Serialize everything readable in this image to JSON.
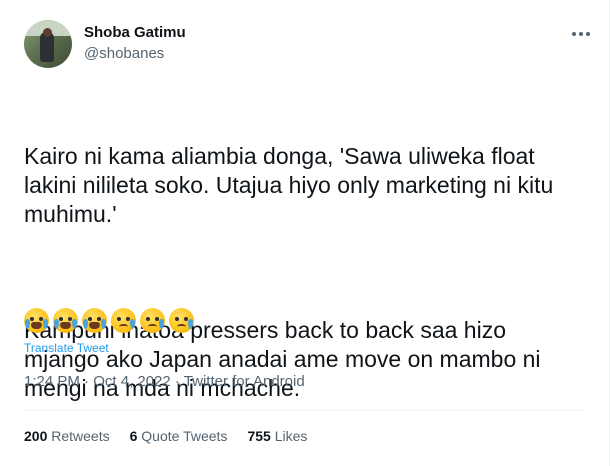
{
  "author": {
    "name": "Shoba Gatimu",
    "handle": "@shobanes"
  },
  "tweet": {
    "paragraph1": "Kairo ni kama aliambia donga, 'Sawa uliweka float lakini nilileta soko. Utajua hiyo only marketing ni kitu muhimu.'",
    "paragraph2": "Kampuni inatoa pressers back to back saa hizo mjango ako Japan anadai ame move on mambo ni mengi na mda ni mchache.",
    "emojis": [
      "loudly-crying-face",
      "loudly-crying-face",
      "loudly-crying-face",
      "face-holding-back-tears",
      "face-holding-back-tears",
      "face-holding-back-tears"
    ],
    "translate_label": "Translate Tweet",
    "meta": "1:24 PM · Oct 4, 2022 · Twitter for Android"
  },
  "stats": {
    "retweets_count": "200",
    "retweets_label": "Retweets",
    "quotes_count": "6",
    "quotes_label": "Quote Tweets",
    "likes_count": "755",
    "likes_label": "Likes"
  },
  "colors": {
    "accent": "#1d9bf0",
    "text": "#0f1419",
    "muted": "#536471"
  }
}
